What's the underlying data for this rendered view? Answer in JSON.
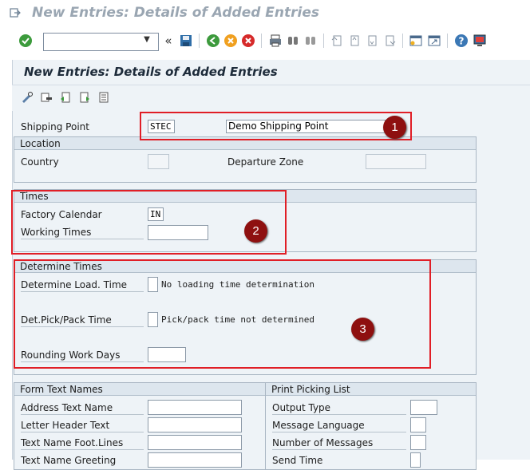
{
  "window": {
    "title": "New Entries: Details of Added Entries"
  },
  "toolbar": {
    "command_field": {
      "value": "",
      "placeholder": ""
    },
    "history_glyph": "«"
  },
  "screen": {
    "title": "New Entries: Details of Added Entries"
  },
  "header": {
    "shipping_point_label": "Shipping Point",
    "shipping_point_value": "STEC",
    "shipping_point_desc": "Demo Shipping Point"
  },
  "location": {
    "title": "Location",
    "country_label": "Country",
    "country_value": "",
    "departure_zone_label": "Departure Zone",
    "departure_zone_value": ""
  },
  "times": {
    "title": "Times",
    "factory_calendar_label": "Factory Calendar",
    "factory_calendar_value": "IN",
    "working_times_label": "Working Times",
    "working_times_value": ""
  },
  "determine_times": {
    "title": "Determine Times",
    "load_time_label": "Determine Load. Time",
    "load_time_value": "",
    "load_time_desc": "No loading time determination",
    "pick_pack_label": "Det.Pick/Pack Time",
    "pick_pack_value": "",
    "pick_pack_desc": "Pick/pack time not determined",
    "rounding_label": "Rounding Work Days",
    "rounding_value": ""
  },
  "form_text_names": {
    "title": "Form Text Names",
    "address_label": "Address Text Name",
    "letter_header_label": "Letter Header Text",
    "footer_label": "Text Name Foot.Lines",
    "greeting_label": "Text Name Greeting"
  },
  "print_picking": {
    "title": "Print Picking List",
    "output_type_label": "Output Type",
    "message_language_label": "Message Language",
    "number_messages_label": "Number of Messages",
    "send_time_label": "Send Time"
  },
  "annotations": {
    "badge_1": "1",
    "badge_2": "2",
    "badge_3": "3",
    "highlight_color": "#e01e26",
    "badge_color": "#8e1010"
  },
  "icons": {
    "title_bar": [
      "exit-icon"
    ],
    "system": [
      "enter-icon",
      "save-icon",
      "back-icon",
      "exit-session-icon",
      "cancel-icon",
      "print-icon",
      "find-icon",
      "find-next-icon",
      "first-page-icon",
      "previous-page-icon",
      "next-page-icon",
      "last-page-icon",
      "new-session-icon",
      "shortcut-icon",
      "help-icon",
      "customize-layout-icon"
    ],
    "application": [
      "change-display-icon",
      "delete-icon",
      "undo-change-icon",
      "copy-icon",
      "select-all-icon"
    ]
  }
}
